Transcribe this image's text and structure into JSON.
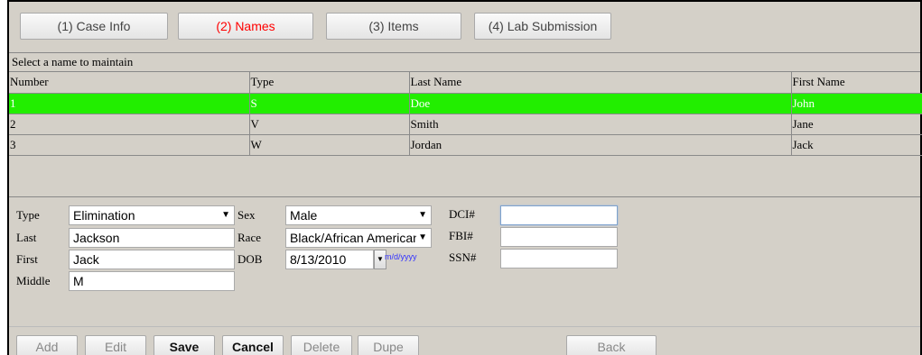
{
  "tabs": [
    {
      "label": "(1) Case Info"
    },
    {
      "label": "(2) Names",
      "active": true
    },
    {
      "label": "(3) Items"
    },
    {
      "label": "(4) Lab Submission"
    }
  ],
  "grid": {
    "caption": "Select a name to maintain",
    "columns": [
      "Number",
      "Type",
      "Last Name",
      "First Name"
    ],
    "rows": [
      {
        "number": "1",
        "type": "S",
        "last": "Doe",
        "first": "John",
        "selected": true
      },
      {
        "number": "2",
        "type": "V",
        "last": "Smith",
        "first": "Jane"
      },
      {
        "number": "3",
        "type": "W",
        "last": "Jordan",
        "first": "Jack"
      }
    ],
    "selected_color": "#22ee00"
  },
  "form": {
    "type_label": "Type",
    "type_value": "Elimination",
    "last_label": "Last",
    "last_value": "Jackson",
    "first_label": "First",
    "first_value": "Jack",
    "middle_label": "Middle",
    "middle_value": "M",
    "sex_label": "Sex",
    "sex_value": "Male",
    "race_label": "Race",
    "race_value": "Black/African American",
    "dob_label": "DOB",
    "dob_value": "8/13/2010",
    "dob_hint": "m/d/yyyy",
    "dci_label": "DCI#",
    "dci_value": "",
    "fbi_label": "FBI#",
    "fbi_value": "",
    "ssn_label": "SSN#",
    "ssn_value": ""
  },
  "buttons": {
    "add": "Add",
    "edit": "Edit",
    "save": "Save",
    "cancel": "Cancel",
    "delete": "Delete",
    "dupe": "Dupe",
    "back": "Back"
  },
  "icons": {
    "dropdown": "triangle-down-icon"
  }
}
